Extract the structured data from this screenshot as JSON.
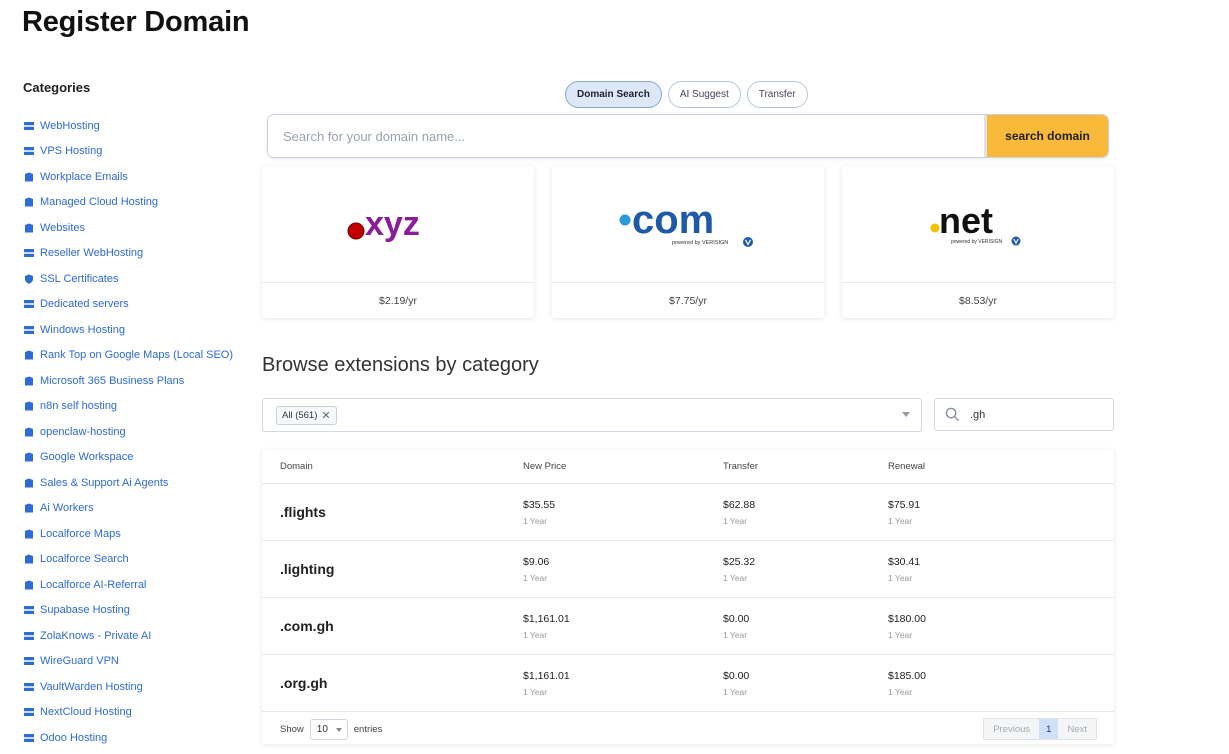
{
  "page": {
    "title": "Register Domain"
  },
  "sidebar": {
    "heading": "Categories",
    "items": [
      {
        "label": "WebHosting",
        "icon": "server-icon"
      },
      {
        "label": "VPS Hosting",
        "icon": "server-icon"
      },
      {
        "label": "Workplace Emails",
        "icon": "box-icon"
      },
      {
        "label": "Managed Cloud Hosting",
        "icon": "box-icon"
      },
      {
        "label": "Websites",
        "icon": "box-icon"
      },
      {
        "label": "Reseller WebHosting",
        "icon": "server-icon"
      },
      {
        "label": "SSL Certificates",
        "icon": "shield-icon"
      },
      {
        "label": "Dedicated servers",
        "icon": "server-icon"
      },
      {
        "label": "Windows Hosting",
        "icon": "server-icon"
      },
      {
        "label": "Rank Top on Google Maps (Local SEO)",
        "icon": "box-icon"
      },
      {
        "label": "Microsoft 365 Business Plans",
        "icon": "box-icon"
      },
      {
        "label": "n8n self hosting",
        "icon": "box-icon"
      },
      {
        "label": "openclaw-hosting",
        "icon": "box-icon"
      },
      {
        "label": "Google Workspace",
        "icon": "box-icon"
      },
      {
        "label": "Sales & Support Ai Agents",
        "icon": "box-icon"
      },
      {
        "label": "Ai Workers",
        "icon": "box-icon"
      },
      {
        "label": "Localforce Maps",
        "icon": "box-icon"
      },
      {
        "label": "Localforce Search",
        "icon": "box-icon"
      },
      {
        "label": "Localforce AI-Referral",
        "icon": "box-icon"
      },
      {
        "label": "Supabase Hosting",
        "icon": "server-icon"
      },
      {
        "label": "ZolaKnows - Private AI",
        "icon": "server-icon"
      },
      {
        "label": "WireGuard VPN",
        "icon": "server-icon"
      },
      {
        "label": "VaultWarden Hosting",
        "icon": "server-icon"
      },
      {
        "label": "NextCloud Hosting",
        "icon": "server-icon"
      },
      {
        "label": "Odoo Hosting",
        "icon": "server-icon"
      }
    ]
  },
  "tabs": [
    {
      "label": "Domain Search",
      "active": true
    },
    {
      "label": "AI Suggest",
      "active": false
    },
    {
      "label": "Transfer",
      "active": false
    }
  ],
  "search": {
    "placeholder": "Search for your domain name...",
    "value": "",
    "button_label": "search domain"
  },
  "featured": [
    {
      "tld": "xyz",
      "price": "$2.19/yr",
      "dot_color": "#c00000",
      "text_color": "#8a1c9a"
    },
    {
      "tld": "com",
      "price": "$7.75/yr",
      "dot_color": "#2a9bd6",
      "text_color": "#1e5aa8",
      "powered": "powered by VERISIGN"
    },
    {
      "tld": "net",
      "price": "$8.53/yr",
      "dot_color": "#f2c200",
      "text_color": "#111111",
      "powered": "powered by VERISIGN"
    }
  ],
  "browse": {
    "title": "Browse extensions by category",
    "filter_chip": "All (561)",
    "search_value": ".gh"
  },
  "table": {
    "headers": [
      "Domain",
      "New Price",
      "Transfer",
      "Renewal"
    ],
    "rows": [
      {
        "domain": ".flights",
        "new_price": "$35.55",
        "transfer": "$62.88",
        "renewal": "$75.91",
        "term": "1 Year"
      },
      {
        "domain": ".lighting",
        "new_price": "$9.06",
        "transfer": "$25.32",
        "renewal": "$30.41",
        "term": "1 Year"
      },
      {
        "domain": ".com.gh",
        "new_price": "$1,161.01",
        "transfer": "$0.00",
        "renewal": "$180.00",
        "term": "1 Year"
      },
      {
        "domain": ".org.gh",
        "new_price": "$1,161.01",
        "transfer": "$0.00",
        "renewal": "$185.00",
        "term": "1 Year"
      }
    ],
    "footer": {
      "show_label": "Show",
      "entries_value": "10",
      "entries_label": "entries",
      "prev": "Previous",
      "page": "1",
      "next": "Next"
    }
  }
}
